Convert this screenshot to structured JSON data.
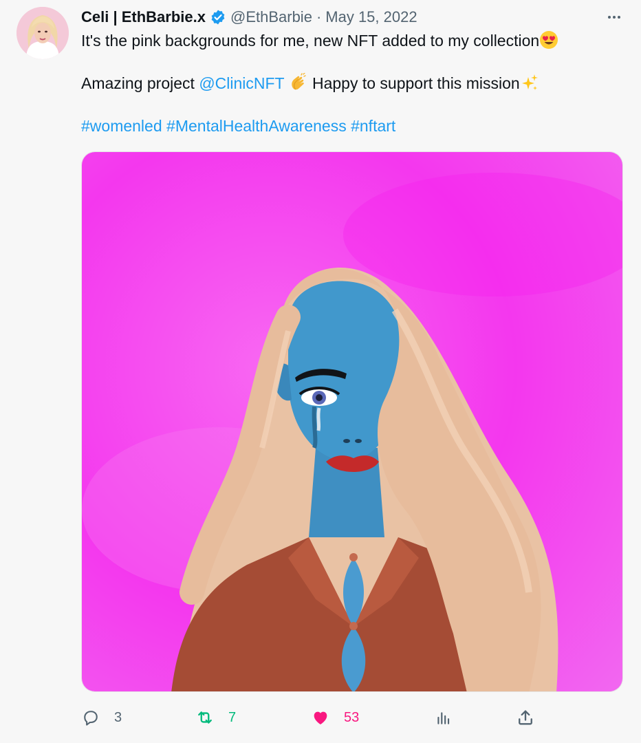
{
  "tweet": {
    "author_name": "Celi | EthBarbie.x",
    "handle": "@EthBarbie",
    "separator": "·",
    "date": "May 15, 2022",
    "more_label": "···",
    "line1_text": "It's the pink backgrounds for me, new NFT added to my collection",
    "line2_prefix": "Amazing project ",
    "line2_mention": "@ClinicNFT",
    "line2_suffix": " Happy to support this mission",
    "hashtags": [
      "#womenled",
      "#MentalHealthAwareness",
      "#nftart"
    ],
    "icons": {
      "verified": "verified-badge-icon",
      "heart_eyes": "heart-eyes-emoji",
      "clap": "clapping-hands-emoji",
      "sparkles": "sparkles-emoji"
    }
  },
  "actions": {
    "reply_count": "3",
    "retweet_count": "7",
    "like_count": "53"
  },
  "colors": {
    "link": "#1d9bf0",
    "retweet": "#00ba7c",
    "like": "#f91880",
    "muted": "#536471",
    "media_background": "#f52ef0"
  }
}
